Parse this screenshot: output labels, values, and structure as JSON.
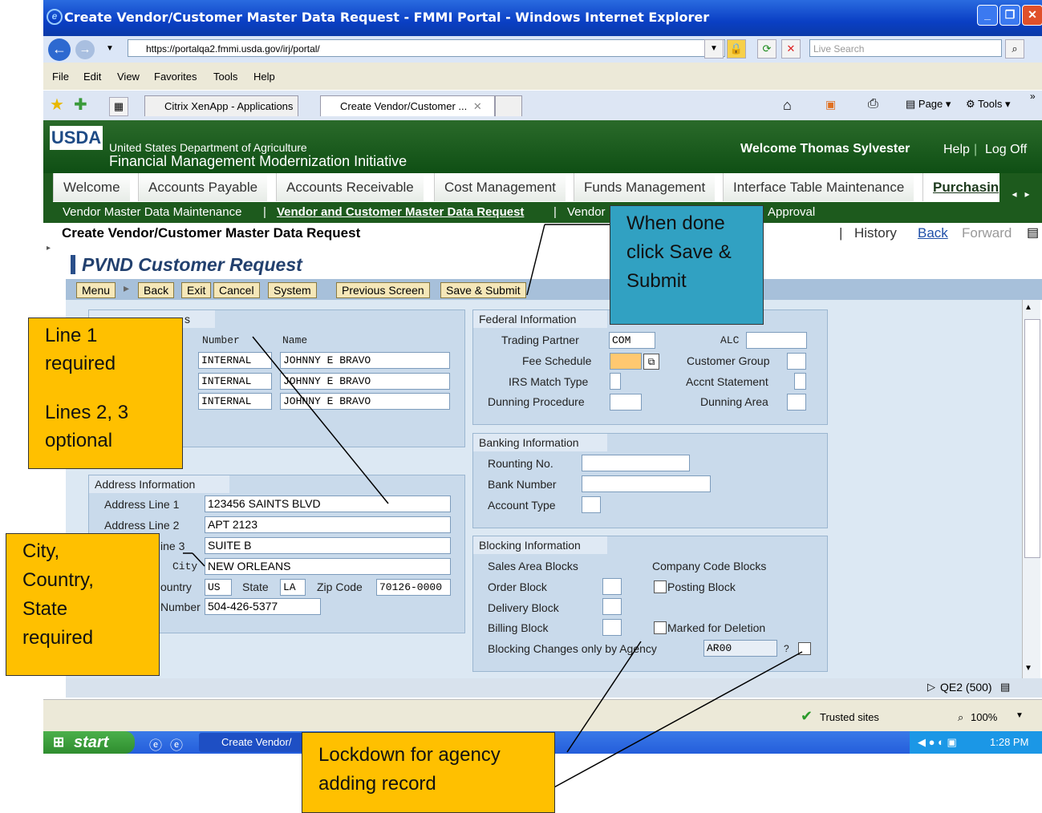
{
  "browser": {
    "title": "Create Vendor/Customer Master Data Request - FMMI Portal - Windows Internet Explorer",
    "url": "https://portalqa2.fmmi.usda.gov/irj/portal/",
    "search_placeholder": "Live Search",
    "menu": [
      "File",
      "Edit",
      "View",
      "Favorites",
      "Tools",
      "Help"
    ],
    "tabs": [
      "Citrix XenApp - Applications",
      "Create Vendor/Customer ..."
    ],
    "tools": {
      "page": "Page",
      "tools": "Tools"
    },
    "status": {
      "zone": "Trusted sites",
      "zoom": "100%"
    }
  },
  "portal": {
    "agency_line1": "United States Department of Agriculture",
    "agency_line2": "Financial Management Modernization Initiative",
    "logo": "USDA",
    "welcome": "Welcome Thomas Sylvester",
    "help": "Help",
    "logoff": "Log Off",
    "top_nav": [
      "Welcome",
      "Accounts Payable",
      "Accounts Receivable",
      "Cost Management",
      "Funds Management",
      "Interface Table Maintenance",
      "Purchasin"
    ],
    "sub_nav": {
      "item1": "Vendor Master Data Maintenance",
      "sep": "|",
      "item2": "Vendor and Customer Master Data Request",
      "item3": "Vendor",
      "item4": "Approval"
    },
    "page_title": "Create Vendor/Customer Master Data Request",
    "history": "History",
    "back": "Back",
    "forward": "Forward",
    "bar": "|"
  },
  "form": {
    "title": "PVND Customer Request",
    "toolbar": {
      "menu": "Menu",
      "back": "Back",
      "exit": "Exit",
      "cancel": "Cancel",
      "system": "System",
      "previous": "Previous Screen",
      "save_submit": "Save & Submit"
    },
    "partner": {
      "title": "s",
      "col_number": "Number",
      "col_name": "Name",
      "rows": [
        {
          "number": "INTERNAL",
          "name": "JOHNNY E BRAVO"
        },
        {
          "number": "INTERNAL",
          "name": "JOHNNY E BRAVO"
        },
        {
          "number": "INTERNAL",
          "name": "JOHNNY E BRAVO"
        }
      ]
    },
    "address": {
      "title": "Address Information",
      "line1_label": "Address Line 1",
      "line1": "123456 SAINTS BLVD",
      "line2_label": "Address Line 2",
      "line2": "APT 2123",
      "line3_label": "ine 3",
      "line3": "SUITE B",
      "city_label": "City",
      "city": "NEW ORLEANS",
      "country_label": "ountry",
      "country": "US",
      "state_label": "State",
      "state": "LA",
      "zip_label": "Zip Code",
      "zip": "70126-0000",
      "phone_label": "Number",
      "phone": "504-426-5377"
    },
    "federal": {
      "title": "Federal Information",
      "trading_partner_label": "Trading Partner",
      "trading_partner": "COM",
      "alc_label": "ALC",
      "fee_schedule_label": "Fee Schedule",
      "customer_group_label": "Customer Group",
      "irs_label": "IRS Match Type",
      "accnt_label": "Accnt Statement",
      "dunning_proc_label": "Dunning Procedure",
      "dunning_area_label": "Dunning Area"
    },
    "banking": {
      "title": "Banking Information",
      "routing_label": "Rounting No.",
      "bank_label": "Bank Number",
      "type_label": "Account Type"
    },
    "blocking": {
      "title": "Blocking Information",
      "sales_label": "Sales Area Blocks",
      "company_label": "Company Code Blocks",
      "order_label": "Order Block",
      "posting_label": "Posting Block",
      "delivery_label": "Delivery Block",
      "billing_label": "Billing Block",
      "deletion_label": "Marked for Deletion",
      "changes_label": "Blocking Changes only by Agency",
      "changes_value": "AR00",
      "q": "?"
    },
    "system_status": "QE2 (500)"
  },
  "taskbar": {
    "start": "start",
    "task": "Create Vendor/",
    "time": "1:28 PM"
  },
  "callouts": {
    "done": [
      "When done",
      "click Save &",
      "Submit"
    ],
    "line1": [
      "Line 1",
      "required",
      "",
      "Lines 2, 3",
      "optional"
    ],
    "city": [
      "City,",
      "Country,",
      "State",
      "required"
    ],
    "lockdown": [
      "Lockdown for agency",
      "adding record"
    ]
  },
  "colors": {
    "usda_green": "#1d5a1d",
    "callout_yellow": "#ffc000",
    "callout_blue": "#31a1c2",
    "form_bg": "#dce8f3"
  }
}
